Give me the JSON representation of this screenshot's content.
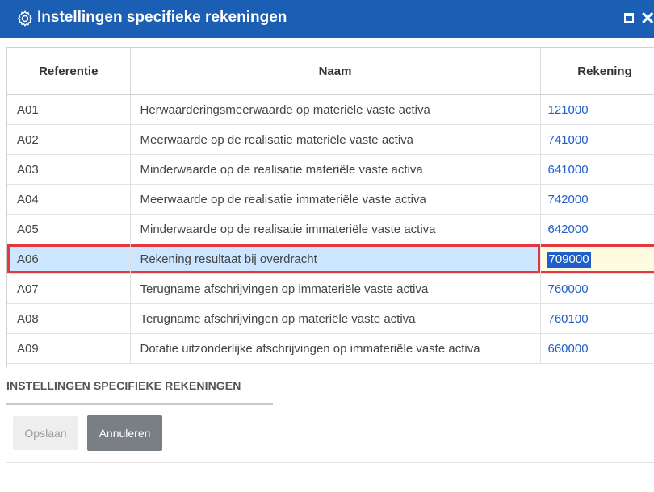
{
  "window": {
    "title": "Instellingen specifieke rekeningen",
    "title_icon": "gear-icon",
    "maximize_icon": "maximize-icon",
    "close_icon": "close-icon",
    "close_glyph": "✕",
    "titlebar_color": "#1a5fb4"
  },
  "grid": {
    "columns": [
      "Referentie",
      "Naam",
      "Rekening"
    ],
    "rows": [
      {
        "ref": "A01",
        "name": "Herwaarderingsmeerwaarde op materiële vaste activa",
        "account": "121000"
      },
      {
        "ref": "A02",
        "name": "Meerwaarde op de realisatie materiële vaste activa",
        "account": "741000"
      },
      {
        "ref": "A03",
        "name": "Minderwaarde op de realisatie materiële vaste activa",
        "account": "641000"
      },
      {
        "ref": "A04",
        "name": "Meerwaarde op de realisatie immateriële vaste activa",
        "account": "742000"
      },
      {
        "ref": "A05",
        "name": "Minderwaarde op de realisatie immateriële vaste activa",
        "account": "642000"
      },
      {
        "ref": "A06",
        "name": "Rekening resultaat bij overdracht",
        "account": "709000",
        "selected": true
      },
      {
        "ref": "A07",
        "name": "Terugname afschrijvingen op immateriële vaste activa",
        "account": "760000"
      },
      {
        "ref": "A08",
        "name": "Terugname afschrijvingen op materiële vaste activa",
        "account": "760100"
      },
      {
        "ref": "A09",
        "name": "Dotatie uitzonderlijke afschrijvingen op immateriële vaste activa",
        "account": "660000"
      }
    ],
    "selection_border_color": "#e0383e",
    "selection_bg_color": "#cce6ff",
    "account_link_color": "#1f5fc7",
    "lookup_icon": "search-icon"
  },
  "footer": {
    "section_title": "INSTELLINGEN SPECIFIEKE REKENINGEN",
    "save_label": "Opslaan",
    "cancel_label": "Annuleren"
  }
}
